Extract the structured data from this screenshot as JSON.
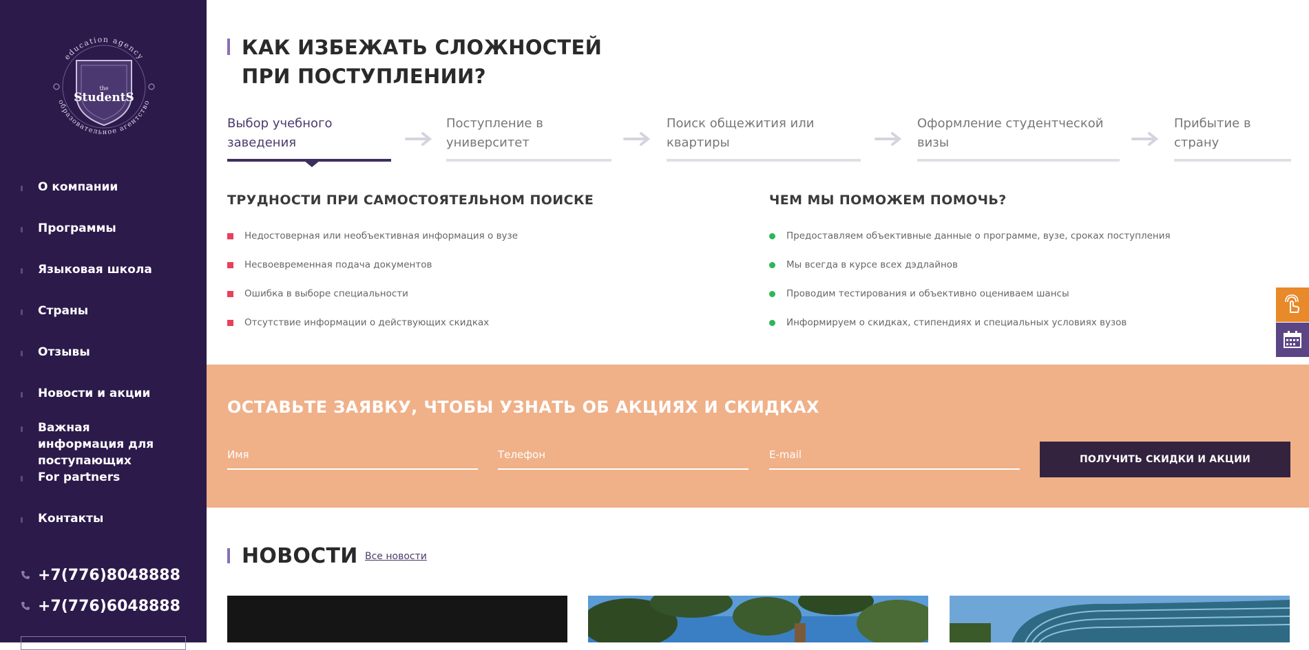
{
  "brand": {
    "ring_top": "education agency",
    "ring_bottom": "образовательное агентство",
    "logo_text": "StudentS",
    "logo_small": "the"
  },
  "nav": {
    "items": [
      {
        "label": "О компании"
      },
      {
        "label": "Программы"
      },
      {
        "label": "Языковая школа"
      },
      {
        "label": "Страны"
      },
      {
        "label": "Отзывы"
      },
      {
        "label": "Новости и акции"
      },
      {
        "label": "Важная информация для поступающих"
      },
      {
        "label": "For partners"
      },
      {
        "label": "Контакты"
      }
    ]
  },
  "contacts": {
    "phones": [
      "+7(776)8048888",
      "+7(776)6048888"
    ]
  },
  "section": {
    "title_line1": "КАК ИЗБЕЖАТЬ СЛОЖНОСТЕЙ",
    "title_line2": "ПРИ ПОСТУПЛЕНИИ?"
  },
  "steps": [
    {
      "line1": "Выбор учебного",
      "line2": "заведения",
      "active": true
    },
    {
      "line1": "Поступление в",
      "line2": "университет",
      "active": false
    },
    {
      "line1": "Поиск общежития или",
      "line2": "квартиры",
      "active": false
    },
    {
      "line1": "Оформление студентческой",
      "line2": "визы",
      "active": false
    },
    {
      "line1": "Прибытие в",
      "line2": "страну",
      "active": false
    }
  ],
  "problems": {
    "title": "ТРУДНОСТИ ПРИ САМОСТОЯТЕЛЬНОМ ПОИСКЕ",
    "items": [
      "Недостоверная или необъективная информация о вузе",
      "Несвоевременная подача документов",
      "Ошибка в выборе специальности",
      "Отсутствие информации о действующих скидках"
    ]
  },
  "solutions": {
    "title": "ЧЕМ МЫ ПОМОЖЕМ ПОМОЧЬ?",
    "items": [
      "Предоставляем объективные данные о программе, вузе, сроках поступления",
      "Мы всегда в курсе всех дэдлайнов",
      "Проводим тестирования и объективно оцениваем шансы",
      "Информируем о скидках, стипендиях и специальных условиях вузов"
    ]
  },
  "promo": {
    "title": "ОСТАВЬТЕ ЗАЯВКУ, ЧТОБЫ УЗНАТЬ ОБ АКЦИЯХ И СКИДКАХ",
    "name_placeholder": "Имя",
    "phone_placeholder": "Телефон",
    "email_placeholder": "E-mail",
    "button_label": "ПОЛУЧИТЬ СКИДКИ И АКЦИИ"
  },
  "news": {
    "title": "НОВОСТИ",
    "all_link": "Все новости"
  },
  "colors": {
    "sidebar": "#2c1a4b",
    "accent": "#8a6fb5",
    "promo": "#f0b088",
    "button": "#33233f",
    "problem_marker": "#e8405d",
    "solution_marker": "#2bb65a",
    "float_orange": "#e8892a",
    "float_purple": "#5b4585"
  },
  "icons": {
    "phone": "phone-icon",
    "step_arrow": "arrow-right-icon",
    "callback": "touch-hand-icon",
    "calendar": "calendar-icon"
  }
}
